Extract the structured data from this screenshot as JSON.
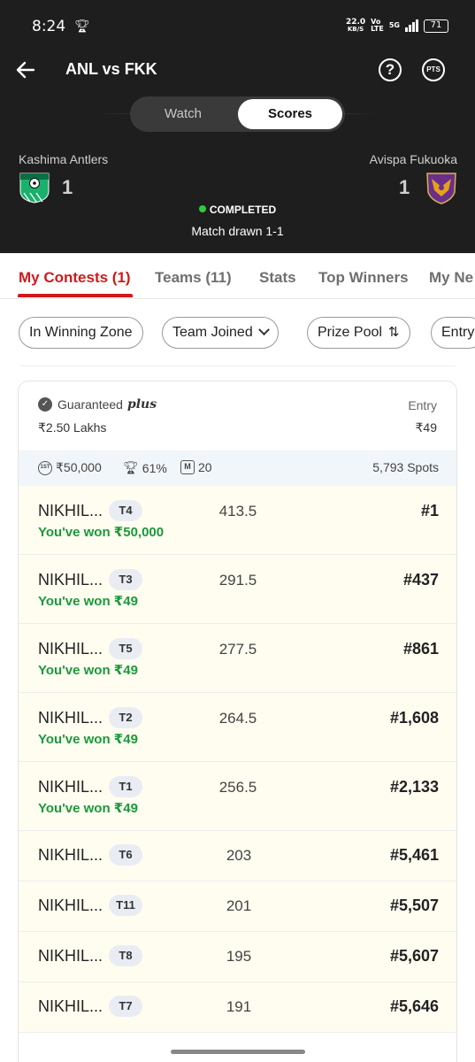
{
  "status_bar": {
    "time": "8:24",
    "speed_value": "22.0",
    "speed_unit": "KB/S",
    "vo_top": "Vo",
    "vo_bottom": "LTE",
    "net": "5G",
    "battery": "71"
  },
  "header": {
    "title": "ANL vs FKK",
    "pts_label": "PTS",
    "help_label": "?"
  },
  "toggle": {
    "watch": "Watch",
    "scores": "Scores"
  },
  "match": {
    "home_name": "Kashima Antlers",
    "home_score": "1",
    "away_name": "Avispa Fukuoka",
    "away_score": "1",
    "status": "COMPLETED",
    "result": "Match drawn 1-1"
  },
  "tabs": [
    "My Contests (1)",
    "Teams (11)",
    "Stats",
    "Top Winners",
    "My Ne"
  ],
  "filters": {
    "winning": "In Winning Zone",
    "team_joined": "Team Joined",
    "prize_pool": "Prize Pool",
    "entry": "Entry"
  },
  "contest": {
    "guaranteed": "Guaranteed",
    "plus": "plus",
    "prize_pool": "₹2.50 Lakhs",
    "entry_label": "Entry",
    "entry_value": "₹49",
    "first_prize": "₹50,000",
    "first_icon_label": "1ST",
    "win_pct": "61%",
    "max_icon": "M",
    "max_teams": "20",
    "spots": "5,793 Spots"
  },
  "rows": [
    {
      "name": "NIKHIL...",
      "team": "T4",
      "points": "413.5",
      "rank": "#1",
      "won": "You've won ₹50,000"
    },
    {
      "name": "NIKHIL...",
      "team": "T3",
      "points": "291.5",
      "rank": "#437",
      "won": "You've won ₹49"
    },
    {
      "name": "NIKHIL...",
      "team": "T5",
      "points": "277.5",
      "rank": "#861",
      "won": "You've won ₹49"
    },
    {
      "name": "NIKHIL...",
      "team": "T2",
      "points": "264.5",
      "rank": "#1,608",
      "won": "You've won ₹49"
    },
    {
      "name": "NIKHIL...",
      "team": "T1",
      "points": "256.5",
      "rank": "#2,133",
      "won": "You've won ₹49"
    },
    {
      "name": "NIKHIL...",
      "team": "T6",
      "points": "203",
      "rank": "#5,461"
    },
    {
      "name": "NIKHIL...",
      "team": "T11",
      "points": "201",
      "rank": "#5,507"
    },
    {
      "name": "NIKHIL...",
      "team": "T8",
      "points": "195",
      "rank": "#5,607"
    },
    {
      "name": "NIKHIL...",
      "team": "T7",
      "points": "191",
      "rank": "#5,646"
    }
  ],
  "colors": {
    "header_bg": "#1e1e1e",
    "accent_red": "#d11a1a",
    "win_green": "#1a9a3b",
    "row_bg": "#fffdf0"
  }
}
